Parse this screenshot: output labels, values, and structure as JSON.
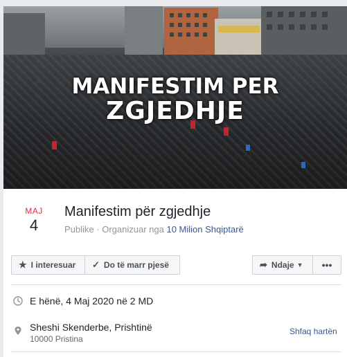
{
  "cover": {
    "title_line1": "MANIFESTIM PER",
    "title_line2": "ZGJEDHJE"
  },
  "event": {
    "month": "MAJ",
    "day": "4",
    "title": "Manifestim për zgjedhje",
    "visibility": "Publike",
    "organized_by_prefix": "Organizuar nga",
    "organizer": "10 Milion Shqiptarë"
  },
  "actions": {
    "interested_label": "I interesuar",
    "going_label": "Do të marr pjesë",
    "share_label": "Ndaje",
    "more_label": "•••"
  },
  "details": {
    "datetime": "E hënë, 4 Maj 2020 në 2 MD",
    "location_name": "Sheshi Skenderbe, Prishtinë",
    "location_sub": "10000 Pristina",
    "map_link": "Shfaq hartën"
  },
  "colors": {
    "month_red": "#f02849",
    "link_blue": "#365899",
    "meta_gray": "#90949c",
    "button_bg": "#f5f6f7"
  },
  "icons": [
    "star-icon",
    "check-icon",
    "share-arrow-icon",
    "caret-down-icon",
    "more-icon",
    "clock-icon",
    "location-pin-icon"
  ]
}
